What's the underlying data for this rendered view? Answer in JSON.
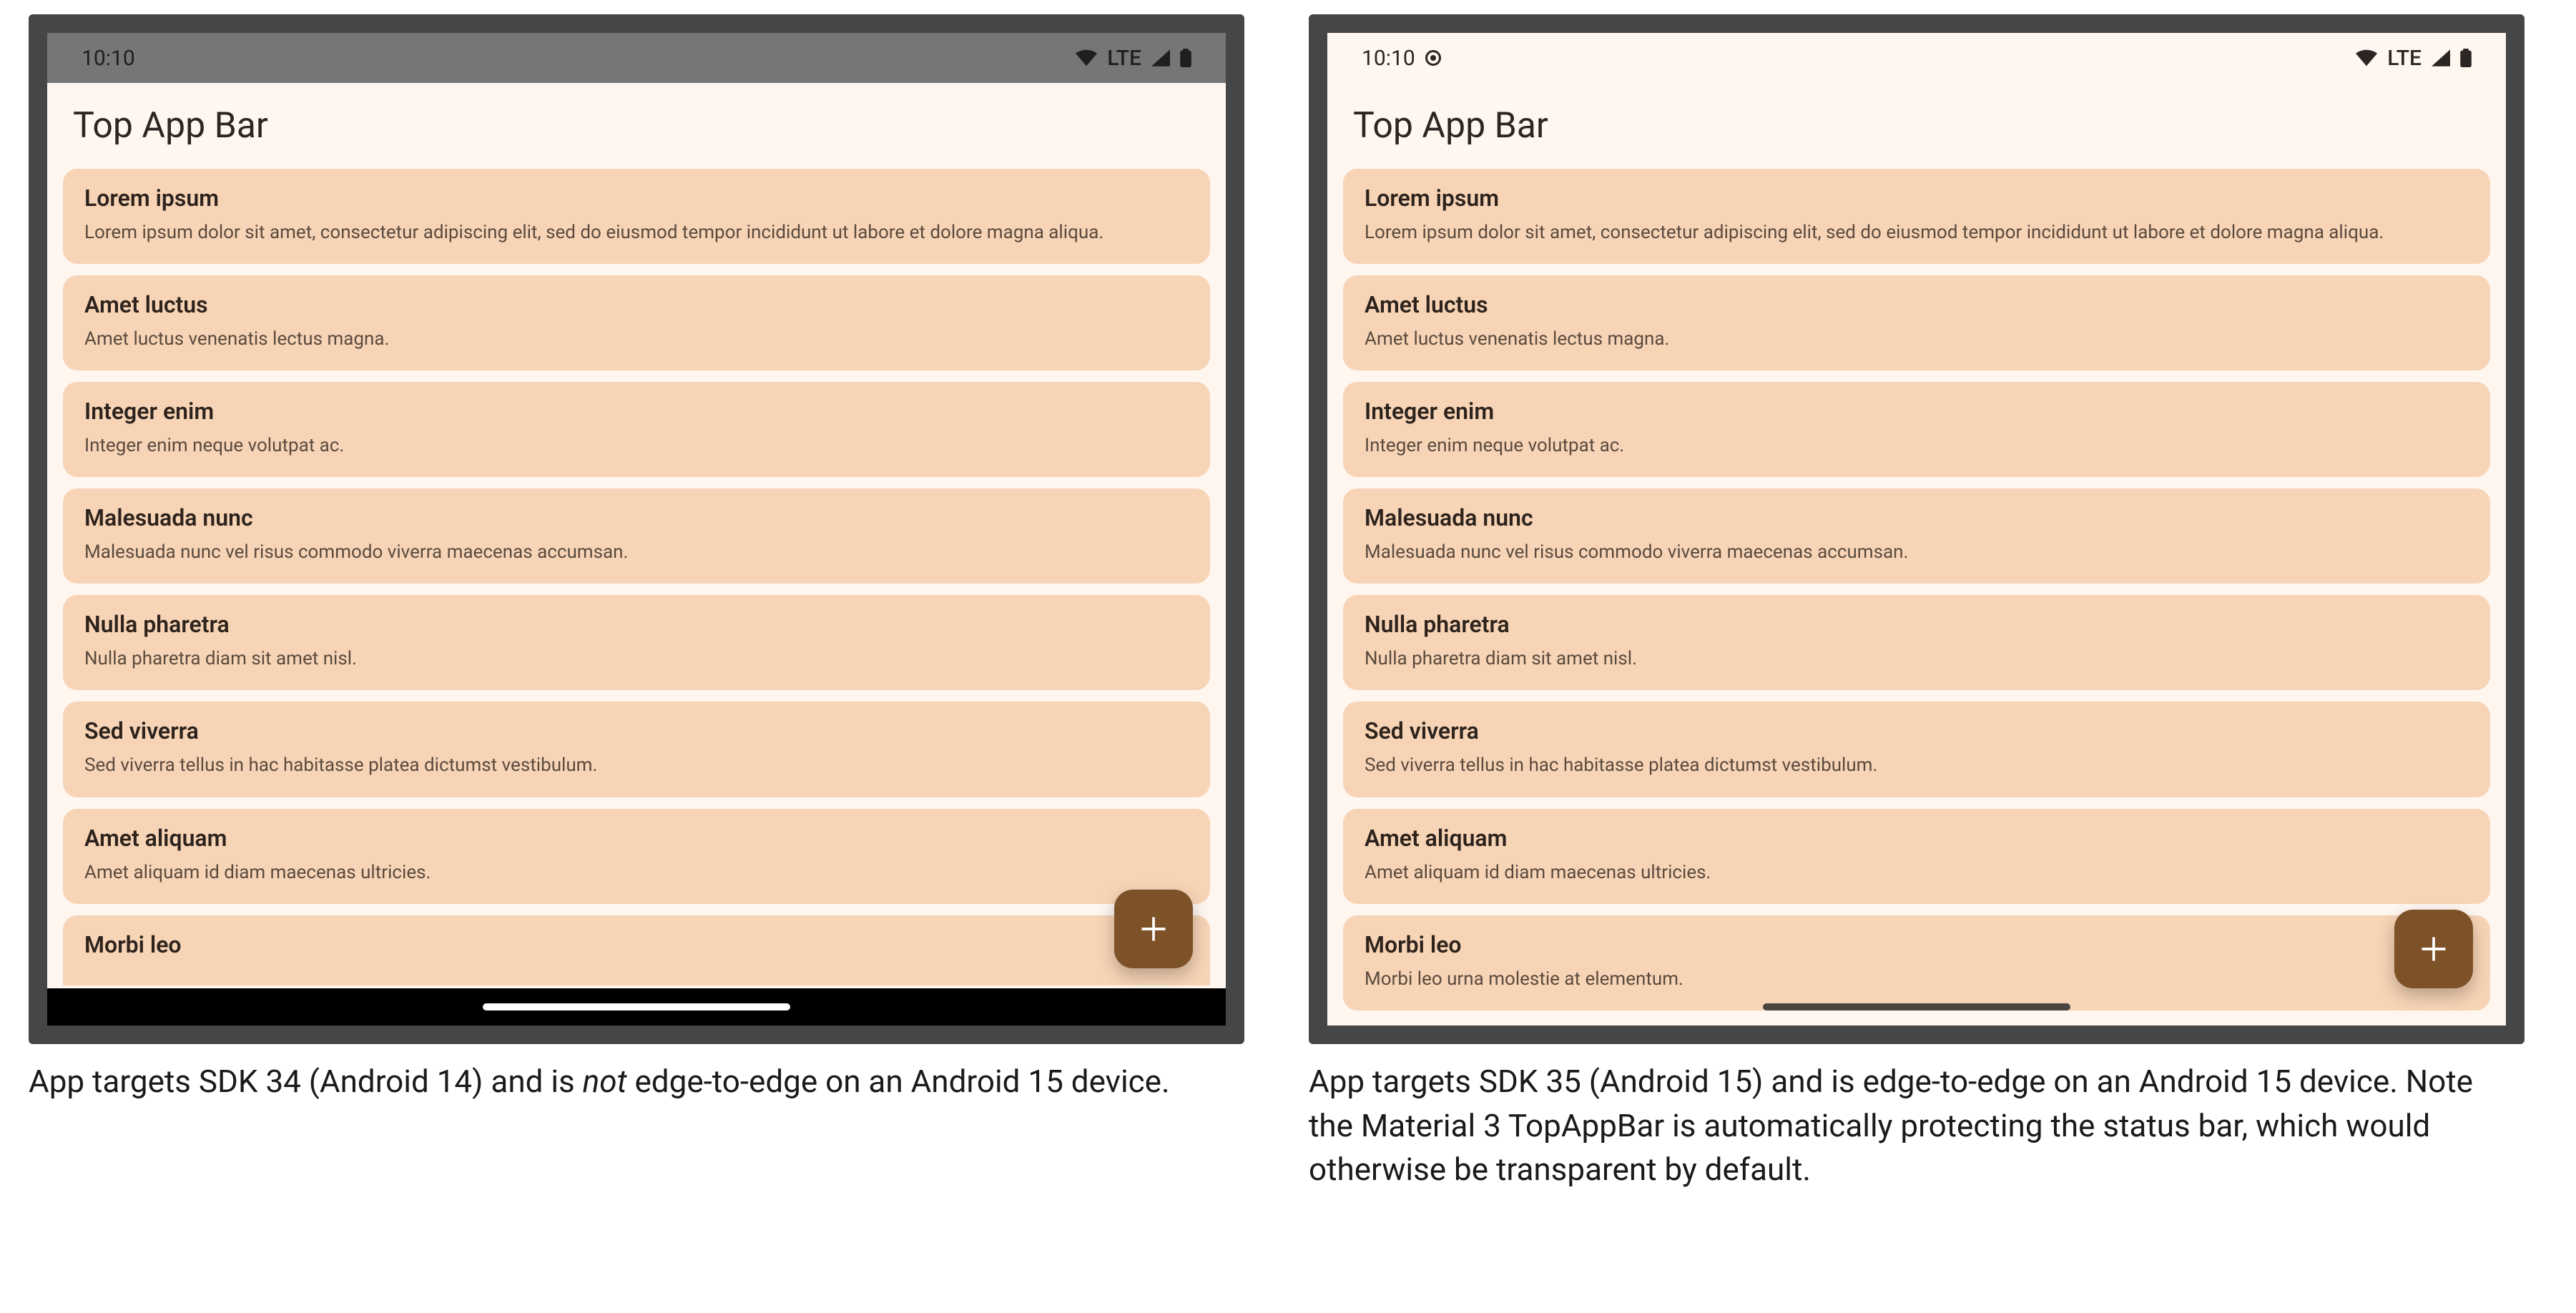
{
  "status": {
    "clock": "10:10",
    "network_label": "LTE"
  },
  "app_bar": {
    "title": "Top App Bar"
  },
  "fab": {
    "icon": "plus-icon"
  },
  "list_items": [
    {
      "title": "Lorem ipsum",
      "body": "Lorem ipsum dolor sit amet, consectetur adipiscing elit, sed do eiusmod tempor incididunt ut labore et dolore magna aliqua."
    },
    {
      "title": "Amet luctus",
      "body": "Amet luctus venenatis lectus magna."
    },
    {
      "title": "Integer enim",
      "body": "Integer enim neque volutpat ac."
    },
    {
      "title": "Malesuada nunc",
      "body": "Malesuada nunc vel risus commodo viverra maecenas accumsan."
    },
    {
      "title": "Nulla pharetra",
      "body": "Nulla pharetra diam sit amet nisl."
    },
    {
      "title": "Sed viverra",
      "body": "Sed viverra tellus in hac habitasse platea dictumst vestibulum."
    },
    {
      "title": "Amet aliquam",
      "body": "Amet aliquam id diam maecenas ultricies."
    },
    {
      "title": "Morbi leo",
      "body": "Morbi leo urna molestie at elementum."
    }
  ],
  "captions": {
    "left_pre": "App targets SDK 34 (Android 14) and is ",
    "left_em": "not",
    "left_post": " edge-to-edge on an Android 15 device.",
    "right": "App targets SDK 35 (Android 15) and is edge-to-edge on an Android 15 device. Note the Material 3 TopAppBar is automatically  protecting the status bar, which would otherwise be transparent by default."
  }
}
